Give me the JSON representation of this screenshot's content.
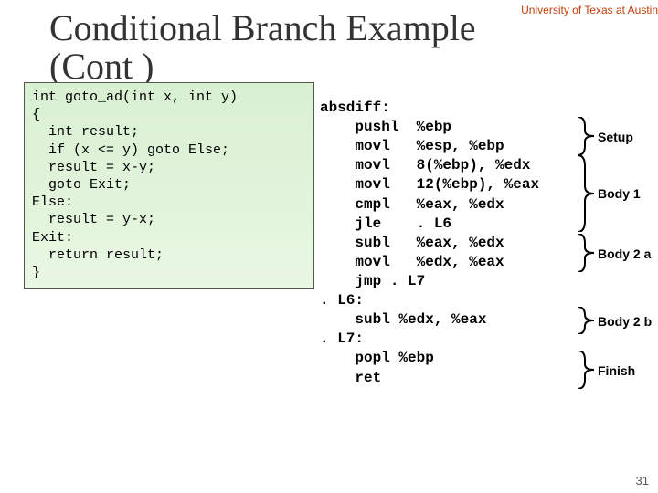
{
  "affiliation": "University of Texas at Austin",
  "title1": "Conditional Branch Example",
  "title2": "(Cont )",
  "c_code": "int goto_ad(int x, int y)\n{\n  int result;\n  if (x <= y) goto Else;\n  result = x-y;\n  goto Exit;\nElse:\n  result = y-x;\nExit:\n  return result;\n}",
  "asm": "absdiff:\n    pushl  %ebp\n    movl   %esp, %ebp\n    movl   8(%ebp), %edx\n    movl   12(%ebp), %eax\n    cmpl   %eax, %edx\n    jle    . L6\n    subl   %eax, %edx\n    movl   %edx, %eax\n    jmp . L7\n. L6:\n    subl %edx, %eax\n. L7:\n    popl %ebp\n    ret",
  "labels": {
    "setup": "Setup",
    "body1": "Body 1",
    "body2a": "Body 2 a",
    "body2b": "Body 2 b",
    "finish": "Finish"
  },
  "slide_number": "31"
}
